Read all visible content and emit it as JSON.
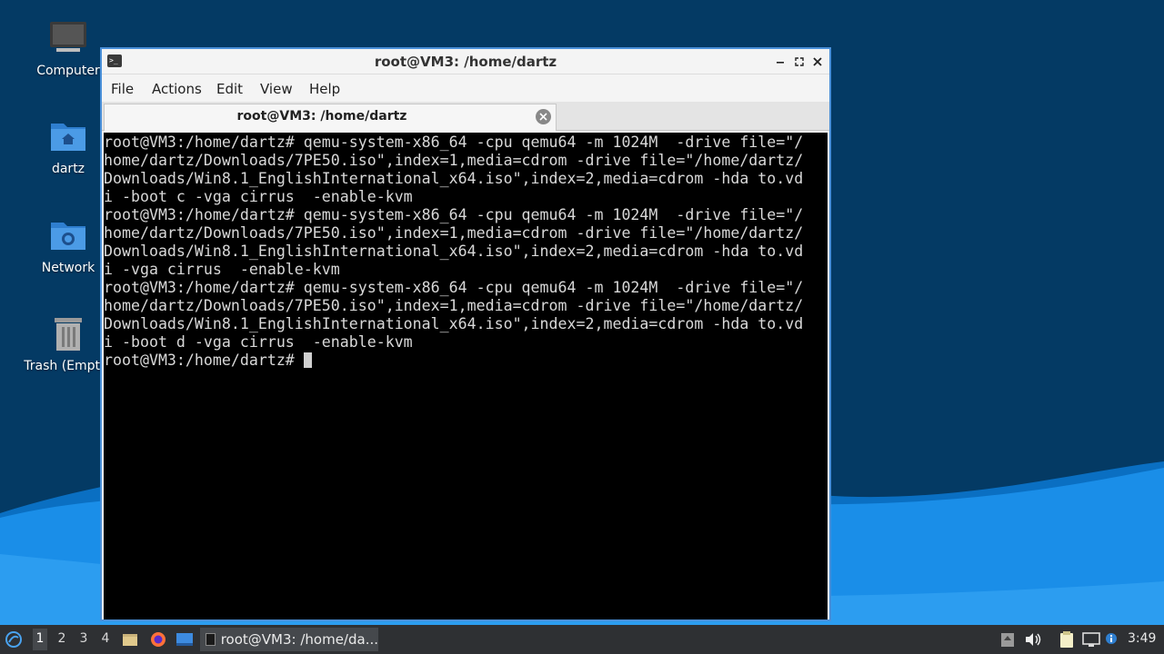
{
  "desktop": {
    "icons": [
      {
        "label": "Computer",
        "icon": "monitor-icon"
      },
      {
        "label": "dartz",
        "icon": "home-folder-icon"
      },
      {
        "label": "Network",
        "icon": "network-folder-icon"
      },
      {
        "label": "Trash (Empty)",
        "icon": "trash-icon"
      }
    ]
  },
  "window": {
    "title": "root@VM3: /home/dartz",
    "menu": [
      "File",
      "Actions",
      "Edit",
      "View",
      "Help"
    ],
    "tab_title": "root@VM3: /home/dartz",
    "terminal_lines": [
      "root@VM3:/home/dartz# qemu-system-x86_64 -cpu qemu64 -m 1024M  -drive file=\"/",
      "home/dartz/Downloads/7PE50.iso\",index=1,media=cdrom -drive file=\"/home/dartz/",
      "Downloads/Win8.1_EnglishInternational_x64.iso\",index=2,media=cdrom -hda to.vd",
      "i -boot c -vga cirrus  -enable-kvm",
      "root@VM3:/home/dartz# qemu-system-x86_64 -cpu qemu64 -m 1024M  -drive file=\"/",
      "home/dartz/Downloads/7PE50.iso\",index=1,media=cdrom -drive file=\"/home/dartz/",
      "Downloads/Win8.1_EnglishInternational_x64.iso\",index=2,media=cdrom -hda to.vd",
      "i -vga cirrus  -enable-kvm",
      "root@VM3:/home/dartz# qemu-system-x86_64 -cpu qemu64 -m 1024M  -drive file=\"/",
      "home/dartz/Downloads/7PE50.iso\",index=1,media=cdrom -drive file=\"/home/dartz/",
      "Downloads/Win8.1_EnglishInternational_x64.iso\",index=2,media=cdrom -hda to.vd",
      "i -boot d -vga cirrus  -enable-kvm"
    ],
    "prompt": "root@VM3:/home/dartz# "
  },
  "taskbar": {
    "workspaces": [
      "1",
      "2",
      "3",
      "4"
    ],
    "active_workspace": "1",
    "task_label": "root@VM3: /home/da...",
    "clock": "3:49"
  },
  "colors": {
    "wallpaper_dark": "#043a64",
    "wallpaper_wave": "#1a8ee8",
    "window_border": "#4a90d9",
    "taskbar_bg": "#2e3033"
  }
}
